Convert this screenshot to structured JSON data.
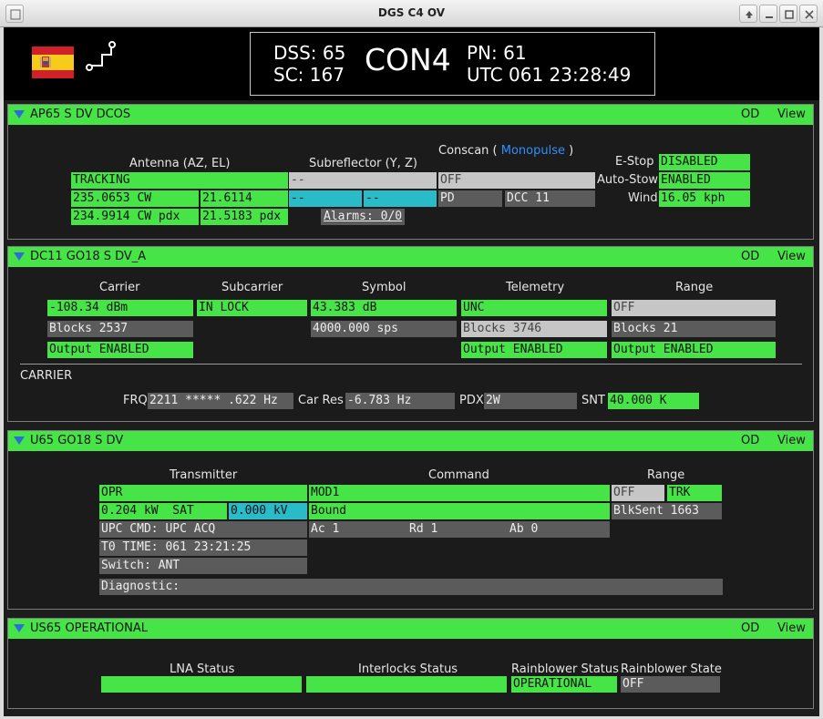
{
  "window": {
    "title": "DGS C4 OV"
  },
  "header": {
    "dss": "DSS: 65",
    "sc": "SC: 167",
    "con": "CON4",
    "pn": "PN: 61",
    "utc": "UTC 061 23:28:49",
    "colors": {
      "green": "#47e447",
      "cyan": "#29bcc8",
      "blue": "#2f8fff"
    }
  },
  "panel1": {
    "title": "AP65 S DV DCOS",
    "od": "OD",
    "view": "View",
    "antenna_label": "Antenna (AZ, EL)",
    "antenna_mode": "TRACKING",
    "az": "235.0653 CW",
    "el": "21.6114",
    "az_pdx": "234.9914 CW pdx",
    "el_pdx": "21.5183 pdx",
    "subreflector_label": "Subreflector (Y, Z)",
    "sub_mode": "--",
    "sub_y": "--",
    "sub_z": "--",
    "alarms": "Alarms: 0/0",
    "conscan_label": "Conscan (",
    "monopulse": "Monopulse",
    "conscan_close": ")",
    "conscan_state": "OFF",
    "pd": "PD",
    "dcc": "DCC 11",
    "estop_label": "E-Stop",
    "estop": "DISABLED",
    "autostow_label": "Auto-Stow",
    "autostow": "ENABLED",
    "wind_label": "Wind",
    "wind": "16.05 kph"
  },
  "panel2": {
    "title": "DC11 GO18 S DV_A",
    "od": "OD",
    "view": "View",
    "carrier_label": "Carrier",
    "carrier": "-108.34 dBm",
    "carrier_blocks": "Blocks 2537",
    "carrier_output": "Output ENABLED",
    "subcarrier_label": "Subcarrier",
    "subcarrier": "IN LOCK",
    "symbol_label": "Symbol",
    "symbol_db": "43.383 dB",
    "symbol_sps": "4000.000 sps",
    "telemetry_label": "Telemetry",
    "telemetry": "UNC",
    "telemetry_blocks": "Blocks 3746",
    "telemetry_output": "Output ENABLED",
    "range_label": "Range",
    "range": "OFF",
    "range_blocks": "Blocks 21",
    "range_output": "Output ENABLED",
    "carrier_section": "CARRIER",
    "frq_label": "FRQ",
    "frq": "2211 ***** .622 Hz",
    "carres_label": "Car Res",
    "carres": "-6.783 Hz",
    "pdx_label": "PDX",
    "pdx": "2W",
    "snt_label": "SNT",
    "snt": "40.000 K"
  },
  "panel3": {
    "title": "U65 GO18 S DV",
    "od": "OD",
    "view": "View",
    "transmitter_label": "Transmitter",
    "tx_state": "OPR",
    "tx_power": "0.204 kW",
    "tx_sat": "SAT",
    "tx_kv": "0.000 kV",
    "upc_cmd": "UPC CMD: UPC ACQ",
    "t0": "T0 TIME: 061 23:21:25",
    "switch": "Switch: ANT",
    "command_label": "Command",
    "cmd_mod": "MOD1",
    "cmd_bound": "Bound",
    "cmd_ac": "Ac 1",
    "cmd_rd": "Rd 1",
    "cmd_ab": "Ab 0",
    "range_label": "Range",
    "range_off": "OFF",
    "range_trk": "TRK",
    "range_blk": "BlkSent 1663",
    "diagnostic": "Diagnostic:"
  },
  "panel4": {
    "title": "US65 OPERATIONAL",
    "od": "OD",
    "view": "View",
    "lna_label": "LNA Status",
    "interlocks_label": "Interlocks Status",
    "rb_status_label": "Rainblower Status",
    "rb_status": "OPERATIONAL",
    "rb_state_label": "Rainblower State",
    "rb_state": "OFF"
  }
}
